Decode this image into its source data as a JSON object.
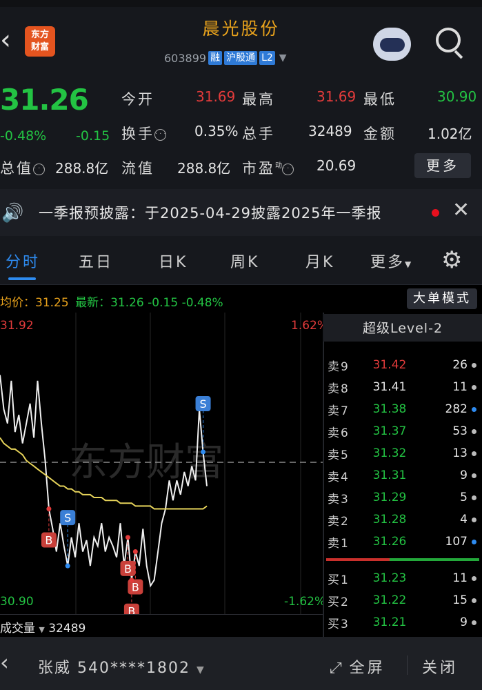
{
  "header": {
    "title": "晨光股份",
    "stock_code": "603899",
    "tags": [
      "融",
      "沪股通",
      "L2"
    ],
    "logo_line1": "东方",
    "logo_line2": "财富"
  },
  "quote": {
    "price": "31.26",
    "change_pct": "-0.48%",
    "change": "-0.15",
    "open_label": "今开",
    "open": "31.69",
    "high_label": "最高",
    "high": "31.69",
    "low_label": "最低",
    "low": "30.90",
    "turnover_label": "换手",
    "turnover": "0.35%",
    "volume_label": "总手",
    "volume": "32489",
    "amount_label": "金额",
    "amount": "1.02亿",
    "total_mv_label": "总值",
    "total_mv": "288.8亿",
    "float_mv_label": "流值",
    "float_mv": "288.8亿",
    "pe_label": "市盈",
    "pe_sup": "动",
    "pe": "20.69",
    "more_label": "更多"
  },
  "notice": {
    "text": "一季报预披露：于2025-04-29披露2025年一季报"
  },
  "tabs": [
    "分时",
    "五日",
    "日K",
    "周K",
    "月K",
    "更多"
  ],
  "infobar": {
    "avg_label": "均价",
    "avg": "31.25",
    "latest_label": "最新",
    "latest": "31.26",
    "latest_chg": "-0.15",
    "latest_pct": "-0.48%",
    "big_order_btn": "大单模式"
  },
  "chart_data": {
    "type": "line",
    "y_top_label": "31.92",
    "y_bottom_label": "30.90",
    "pct_top_label": "1.62%",
    "pct_bottom_label": "-1.62%",
    "ylim": [
      30.9,
      31.92
    ],
    "series": [
      {
        "values": [
          31.72,
          31.6,
          31.55,
          31.7,
          31.52,
          31.58,
          31.48,
          31.55,
          31.62,
          31.5,
          31.7,
          31.55,
          31.42,
          31.25,
          31.18,
          31.1,
          31.2,
          31.12,
          31.05,
          31.15,
          31.08,
          31.2,
          31.1,
          31.14,
          31.05,
          31.15,
          31.12,
          31.2,
          31.1,
          31.15,
          31.12,
          31.08,
          31.2,
          31.05,
          31.15,
          31.0,
          31.1,
          31.05,
          31.18,
          31.05,
          30.98,
          31.0,
          31.1,
          31.2,
          31.25,
          31.35,
          31.28,
          31.35,
          31.3,
          31.38,
          31.33,
          31.4,
          31.35,
          31.6,
          31.45,
          31.33
        ]
      },
      {
        "values": [
          31.5,
          31.48,
          31.47,
          31.46,
          31.46,
          31.45,
          31.44,
          31.42,
          31.41,
          31.4,
          31.39,
          31.38,
          31.37,
          31.36,
          31.35,
          31.34,
          31.33,
          31.33,
          31.32,
          31.32,
          31.31,
          31.31,
          31.3,
          31.3,
          31.3,
          31.29,
          31.29,
          31.29,
          31.28,
          31.28,
          31.28,
          31.28,
          31.27,
          31.27,
          31.27,
          31.27,
          31.26,
          31.26,
          31.26,
          31.26,
          31.26,
          31.25,
          31.25,
          31.25,
          31.25,
          31.25,
          31.25,
          31.25,
          31.25,
          31.25,
          31.25,
          31.25,
          31.25,
          31.25,
          31.25,
          31.26
        ]
      }
    ],
    "markers": [
      {
        "label": "B",
        "index": 13
      },
      {
        "label": "S",
        "index": 18
      },
      {
        "label": "B",
        "index": 34
      },
      {
        "label": "B",
        "index": 36
      },
      {
        "label": "B",
        "index": 35
      },
      {
        "label": "S",
        "index": 54
      }
    ],
    "watermark": "东方财富"
  },
  "orderbook": {
    "title": "超级Level-2",
    "sell": [
      {
        "label": "卖9",
        "price": "31.42",
        "vol": "26",
        "color": "#e33b3b",
        "dot": "#bbbbbb"
      },
      {
        "label": "卖8",
        "price": "31.41",
        "vol": "11",
        "color": "#e6e6e6",
        "dot": "#bbbbbb"
      },
      {
        "label": "卖7",
        "price": "31.38",
        "vol": "282",
        "color": "#23c343",
        "dot": "#2e8bf0"
      },
      {
        "label": "卖6",
        "price": "31.37",
        "vol": "53",
        "color": "#23c343",
        "dot": "#bbbbbb"
      },
      {
        "label": "卖5",
        "price": "31.32",
        "vol": "13",
        "color": "#23c343",
        "dot": "#bbbbbb"
      },
      {
        "label": "卖4",
        "price": "31.31",
        "vol": "9",
        "color": "#23c343",
        "dot": "#bbbbbb"
      },
      {
        "label": "卖3",
        "price": "31.29",
        "vol": "5",
        "color": "#23c343",
        "dot": "#bbbbbb"
      },
      {
        "label": "卖2",
        "price": "31.28",
        "vol": "4",
        "color": "#23c343",
        "dot": "#bbbbbb"
      },
      {
        "label": "卖1",
        "price": "31.26",
        "vol": "107",
        "color": "#23c343",
        "dot": "#2e8bf0"
      }
    ],
    "buy": [
      {
        "label": "买1",
        "price": "31.23",
        "vol": "11",
        "color": "#23c343",
        "dot": "#bbbbbb"
      },
      {
        "label": "买2",
        "price": "31.22",
        "vol": "15",
        "color": "#23c343",
        "dot": "#bbbbbb"
      },
      {
        "label": "买3",
        "price": "31.21",
        "vol": "9",
        "color": "#23c343",
        "dot": "#bbbbbb"
      }
    ]
  },
  "volume": {
    "label": "成交量",
    "value": "32489"
  },
  "bottom": {
    "user": "张威 540****1802",
    "fullscreen": "全屏",
    "close": "关闭"
  }
}
